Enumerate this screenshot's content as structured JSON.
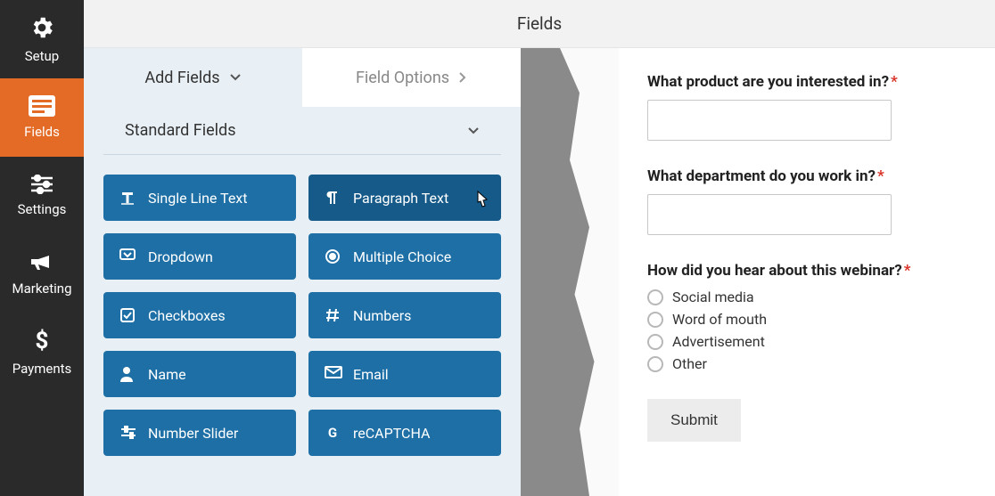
{
  "sidebar": {
    "items": [
      {
        "key": "setup",
        "label": "Setup"
      },
      {
        "key": "fields",
        "label": "Fields"
      },
      {
        "key": "settings",
        "label": "Settings"
      },
      {
        "key": "marketing",
        "label": "Marketing"
      },
      {
        "key": "payments",
        "label": "Payments"
      }
    ],
    "active_index": 1
  },
  "topbar": {
    "title": "Fields"
  },
  "builder": {
    "tabs": [
      {
        "label": "Add Fields",
        "active": true
      },
      {
        "label": "Field Options",
        "active": false
      }
    ],
    "section_title": "Standard Fields",
    "fields": [
      {
        "label": "Single Line Text",
        "icon": "text-icon"
      },
      {
        "label": "Paragraph Text",
        "icon": "paragraph-icon",
        "hover": true
      },
      {
        "label": "Dropdown",
        "icon": "dropdown-icon"
      },
      {
        "label": "Multiple Choice",
        "icon": "radio-icon"
      },
      {
        "label": "Checkboxes",
        "icon": "checkbox-icon"
      },
      {
        "label": "Numbers",
        "icon": "hash-icon"
      },
      {
        "label": "Name",
        "icon": "person-icon"
      },
      {
        "label": "Email",
        "icon": "email-icon"
      },
      {
        "label": "Number Slider",
        "icon": "slider-icon"
      },
      {
        "label": "reCAPTCHA",
        "icon": "google-icon"
      }
    ]
  },
  "preview": {
    "questions": [
      {
        "label": "What product are you interested in?",
        "required": true,
        "type": "text"
      },
      {
        "label": "What department do you work in?",
        "required": true,
        "type": "text"
      },
      {
        "label": "How did you hear about this webinar?",
        "required": true,
        "type": "radio",
        "options": [
          "Social media",
          "Word of mouth",
          "Advertisement",
          "Other"
        ]
      }
    ],
    "submit_label": "Submit"
  }
}
